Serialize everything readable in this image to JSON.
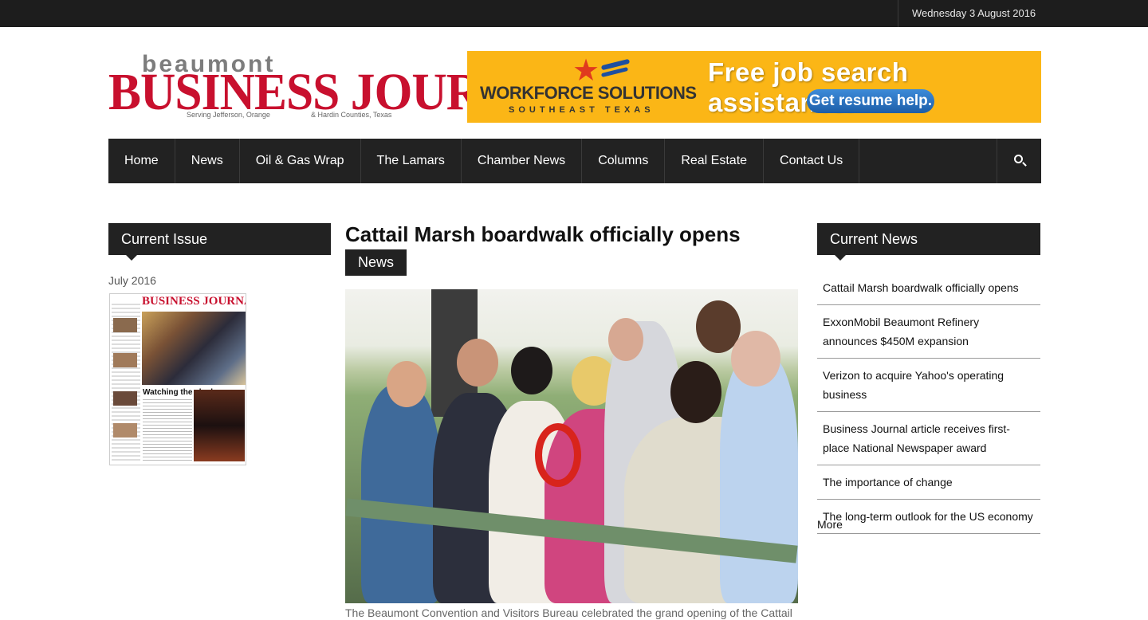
{
  "topbar": {
    "date": "Wednesday 3 August 2016"
  },
  "logo": {
    "top_word": "beaumont",
    "main_words": "BUSINESS JOURNAL",
    "tagline_left": "Serving Jefferson, Orange",
    "tagline_right": "& Hardin Counties, Texas"
  },
  "banner": {
    "brand": "WORKFORCE SOLUTIONS",
    "brand_sub": "SOUTHEAST TEXAS",
    "headline": "Free job search assistance.",
    "button": "Get resume help."
  },
  "nav": {
    "items": [
      {
        "label": "Home"
      },
      {
        "label": "News"
      },
      {
        "label": "Oil & Gas Wrap"
      },
      {
        "label": "The Lamars"
      },
      {
        "label": "Chamber News"
      },
      {
        "label": "Columns"
      },
      {
        "label": "Real Estate"
      },
      {
        "label": "Contact Us"
      }
    ],
    "search_icon": "search-icon"
  },
  "left": {
    "heading": "Current Issue",
    "issue_date": "July 2016",
    "cover": {
      "title": "BUSINESS JOURNAL",
      "headline": "Watching the clock"
    }
  },
  "article": {
    "title": "Cattail Marsh boardwalk officially opens",
    "category": "News",
    "caption": "The Beaumont Convention and Visitors Bureau celebrated the grand opening of the Cattail"
  },
  "right": {
    "heading": "Current News",
    "items": [
      "Cattail Marsh boardwalk officially opens",
      "ExxonMobil Beaumont Refinery announces $450M expansion",
      "Verizon to acquire Yahoo's operating business",
      "Business Journal article receives first-place National Newspaper award",
      "The importance of change",
      "The long-term outlook for the US economy"
    ],
    "more": "More"
  },
  "colors": {
    "dark_bar": "#222222",
    "brand_red": "#c8102e",
    "banner_yellow": "#fbb616"
  }
}
